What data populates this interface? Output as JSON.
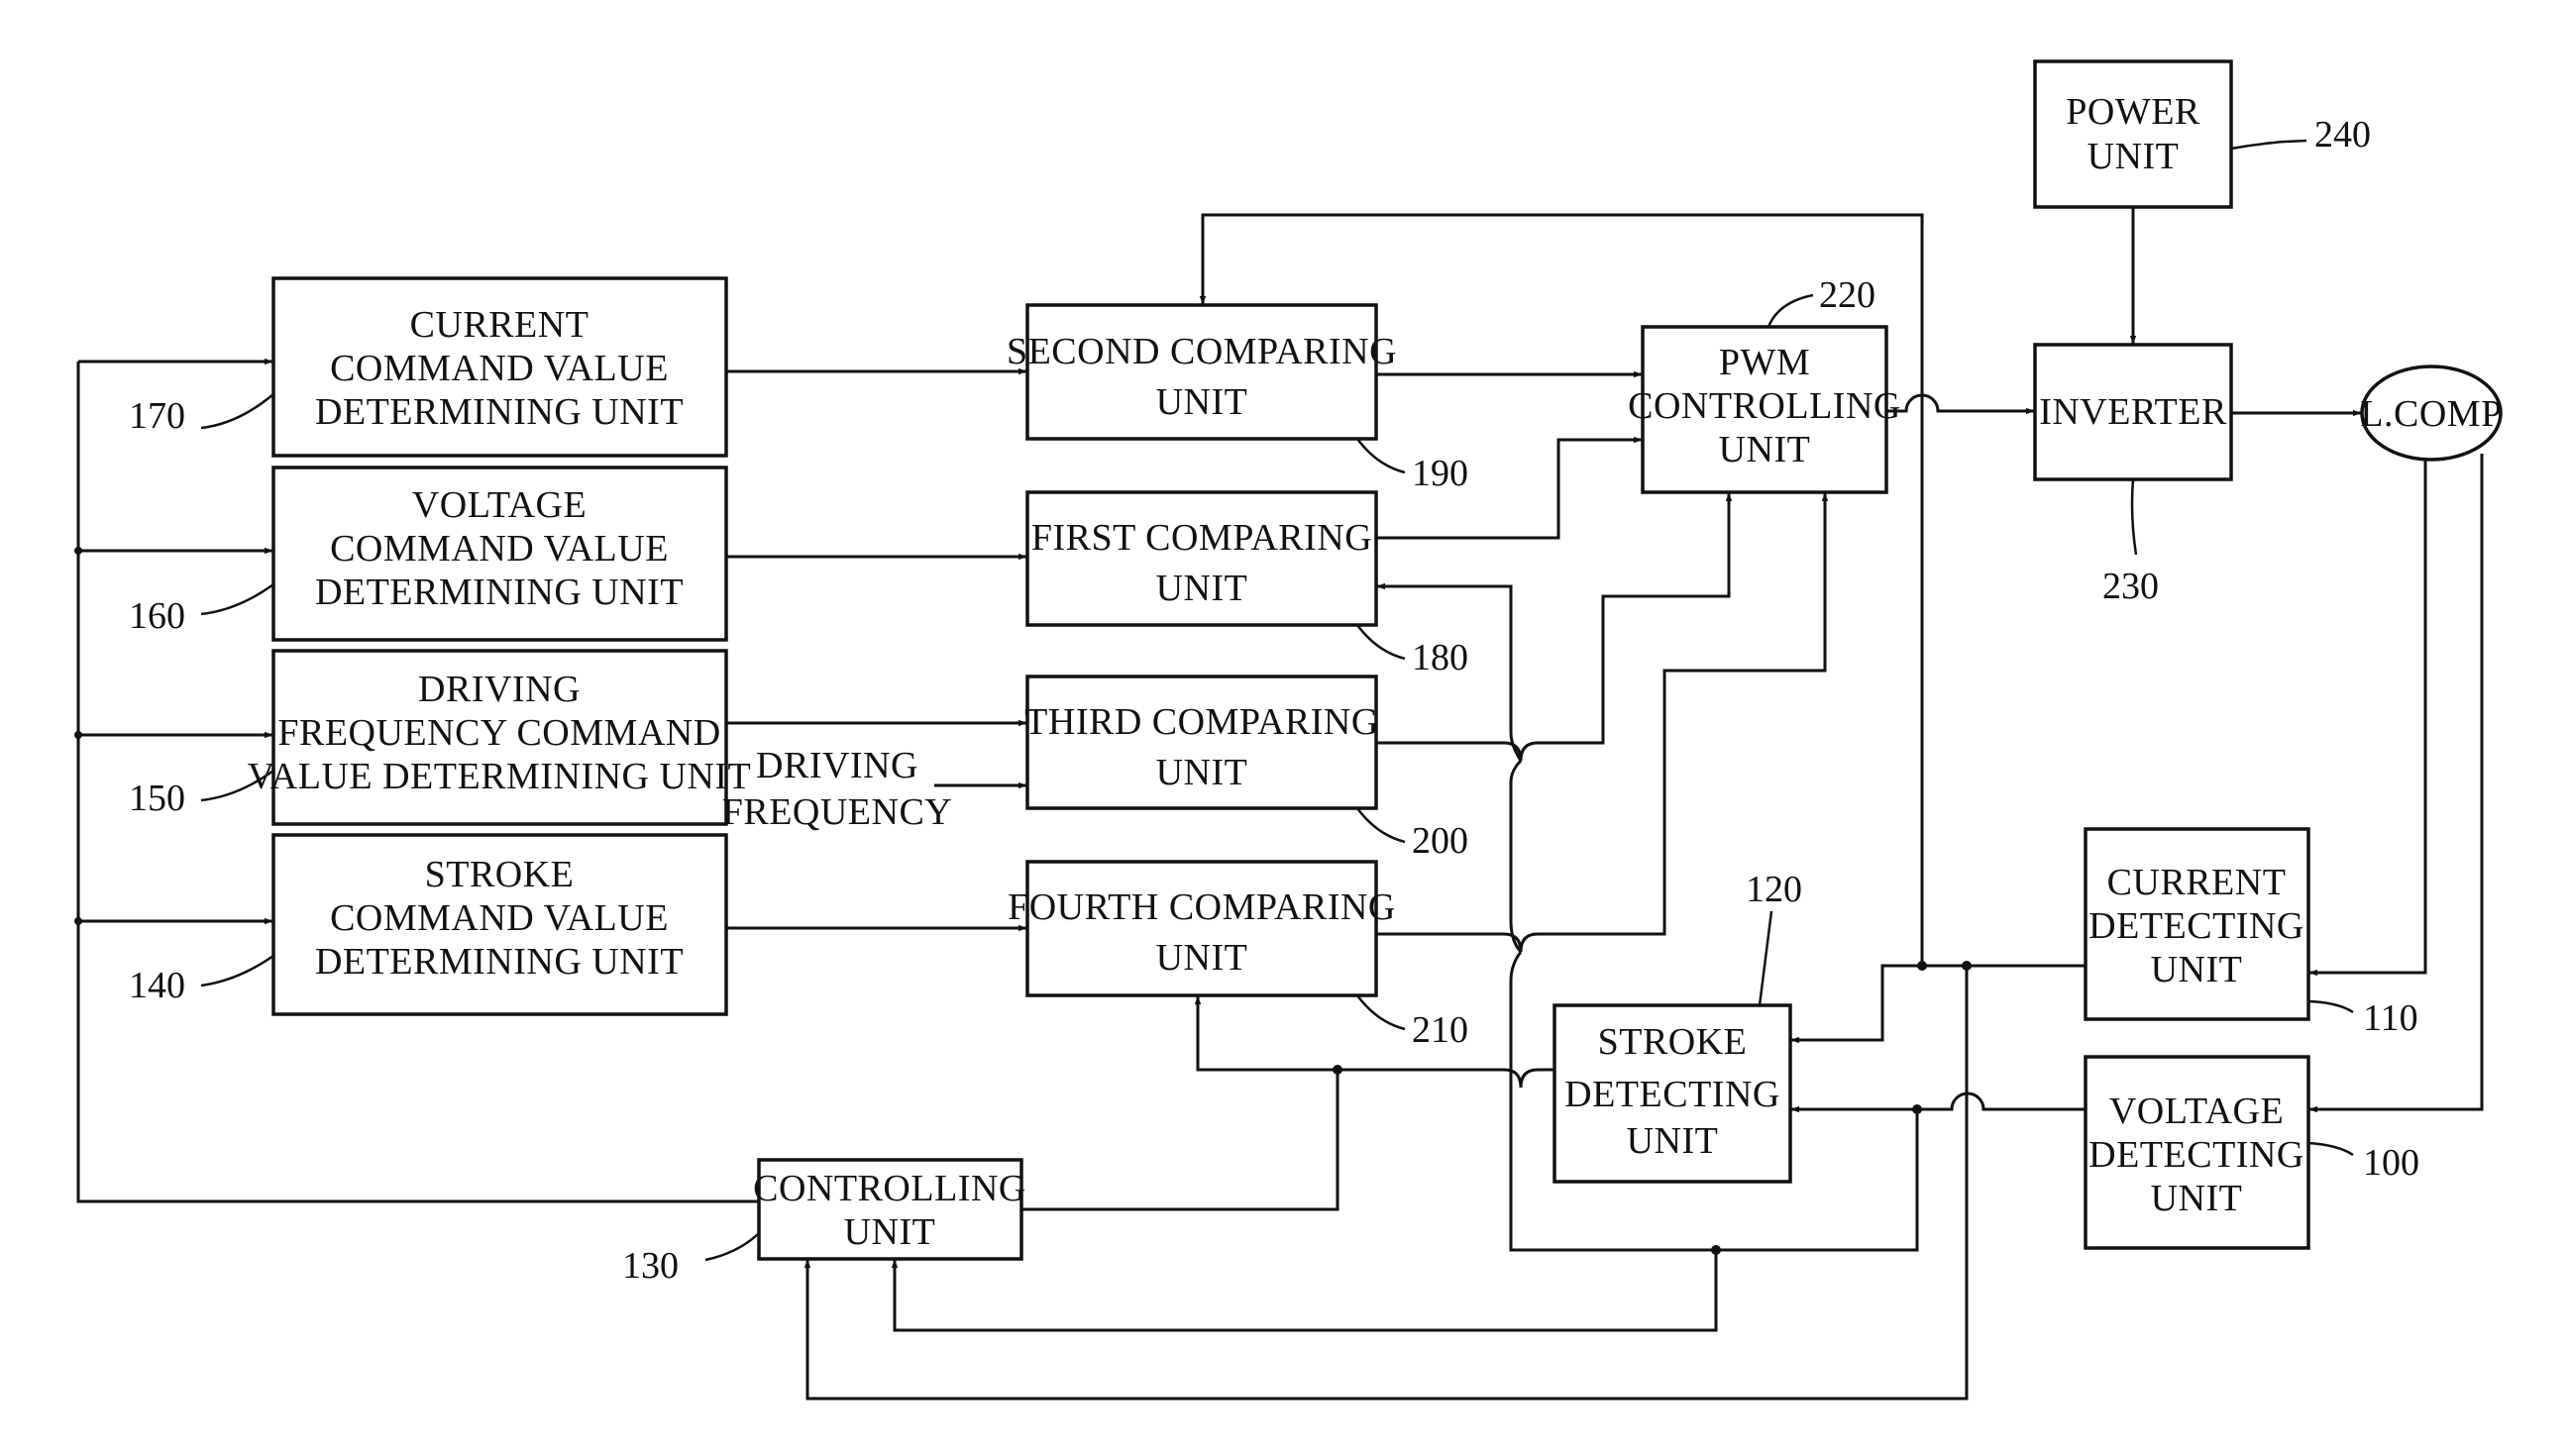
{
  "diagram": {
    "type": "block-diagram",
    "blocks": {
      "current_cmd": {
        "ref": "170",
        "lines": [
          "CURRENT",
          "COMMAND VALUE",
          "DETERMINING UNIT"
        ]
      },
      "voltage_cmd": {
        "ref": "160",
        "lines": [
          "VOLTAGE",
          "COMMAND VALUE",
          "DETERMINING UNIT"
        ]
      },
      "freq_cmd": {
        "ref": "150",
        "lines": [
          "DRIVING",
          "FREQUENCY COMMAND",
          "VALUE DETERMINING UNIT"
        ]
      },
      "stroke_cmd": {
        "ref": "140",
        "lines": [
          "STROKE",
          "COMMAND VALUE",
          "DETERMINING UNIT"
        ]
      },
      "second_cmp": {
        "ref": "190",
        "lines": [
          "SECOND COMPARING",
          "UNIT"
        ]
      },
      "first_cmp": {
        "ref": "180",
        "lines": [
          "FIRST COMPARING",
          "UNIT"
        ]
      },
      "third_cmp": {
        "ref": "200",
        "lines": [
          "THIRD COMPARING",
          "UNIT"
        ]
      },
      "fourth_cmp": {
        "ref": "210",
        "lines": [
          "FOURTH COMPARING",
          "UNIT"
        ]
      },
      "pwm": {
        "ref": "220",
        "lines": [
          "PWM",
          "CONTROLLING",
          "UNIT"
        ]
      },
      "power": {
        "ref": "240",
        "lines": [
          "POWER",
          "UNIT"
        ]
      },
      "inverter": {
        "ref": "230",
        "lines": [
          "INVERTER"
        ]
      },
      "lcomp": {
        "lines": [
          "L.COMP"
        ]
      },
      "current_det": {
        "ref": "110",
        "lines": [
          "CURRENT",
          "DETECTING",
          "UNIT"
        ]
      },
      "voltage_det": {
        "ref": "100",
        "lines": [
          "VOLTAGE",
          "DETECTING",
          "UNIT"
        ]
      },
      "stroke_det": {
        "ref": "120",
        "lines": [
          "STROKE",
          "DETECTING",
          "UNIT"
        ]
      },
      "controller": {
        "ref": "130",
        "lines": [
          "CONTROLLING",
          "UNIT"
        ]
      }
    },
    "external_input": {
      "lines": [
        "DRIVING",
        "FREQUENCY"
      ]
    },
    "connections": [
      {
        "from": "controller",
        "to": "current_cmd"
      },
      {
        "from": "controller",
        "to": "voltage_cmd"
      },
      {
        "from": "controller",
        "to": "freq_cmd"
      },
      {
        "from": "controller",
        "to": "stroke_cmd"
      },
      {
        "from": "current_cmd",
        "to": "second_cmp"
      },
      {
        "from": "voltage_cmd",
        "to": "first_cmp"
      },
      {
        "from": "freq_cmd",
        "to": "third_cmp"
      },
      {
        "from": "driving_frequency",
        "to": "third_cmp"
      },
      {
        "from": "stroke_cmd",
        "to": "fourth_cmp"
      },
      {
        "from": "second_cmp",
        "to": "pwm"
      },
      {
        "from": "first_cmp",
        "to": "pwm"
      },
      {
        "from": "third_cmp",
        "to": "pwm"
      },
      {
        "from": "fourth_cmp",
        "to": "pwm"
      },
      {
        "from": "pwm",
        "to": "inverter"
      },
      {
        "from": "power",
        "to": "inverter"
      },
      {
        "from": "inverter",
        "to": "lcomp"
      },
      {
        "from": "lcomp",
        "to": "current_det"
      },
      {
        "from": "lcomp",
        "to": "voltage_det"
      },
      {
        "from": "current_det",
        "to": "stroke_det"
      },
      {
        "from": "voltage_det",
        "to": "stroke_det"
      },
      {
        "from": "current_det",
        "to": "second_cmp"
      },
      {
        "from": "voltage_det",
        "to": "controller"
      },
      {
        "from": "stroke_det",
        "to": "fourth_cmp"
      },
      {
        "from": "stroke_det",
        "to": "controller"
      },
      {
        "from": "voltage_det",
        "to": "first_cmp"
      }
    ]
  }
}
